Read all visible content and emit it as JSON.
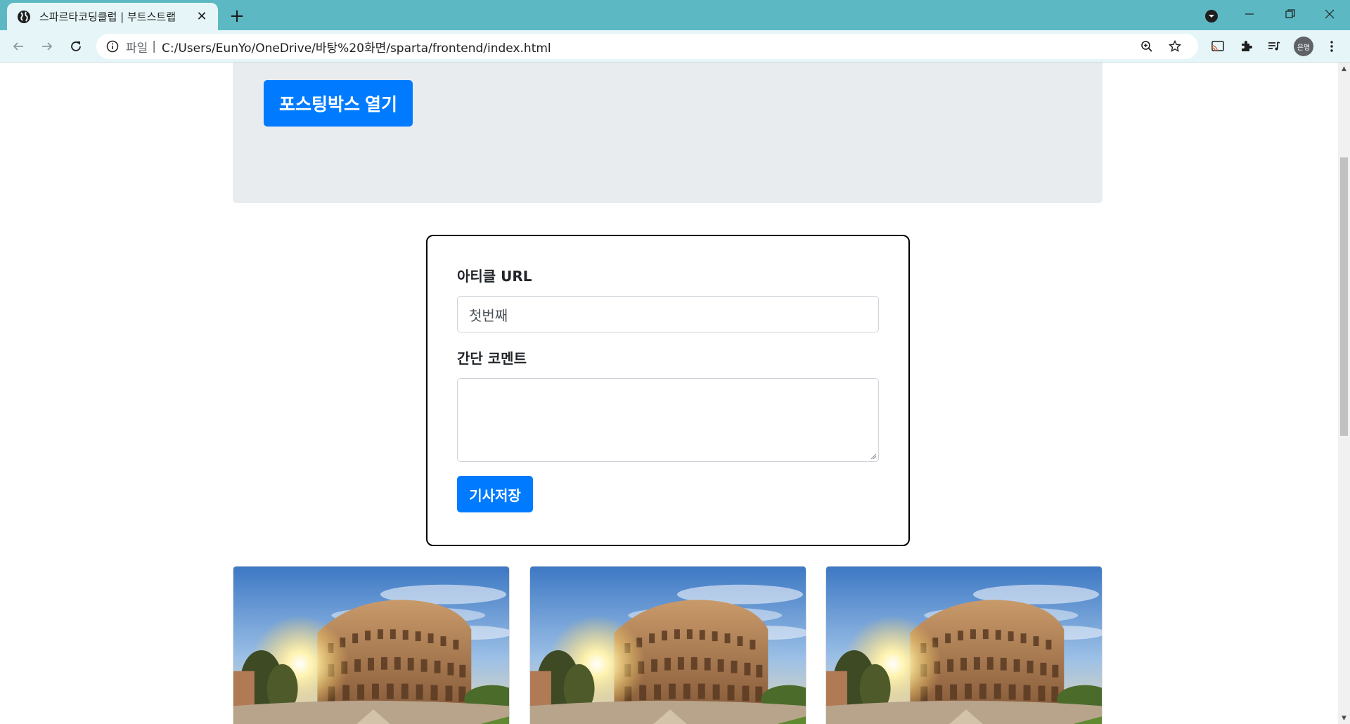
{
  "browser": {
    "tab_title": "스파르타코딩클럽 | 부트스트랩",
    "tab_close": "✕",
    "new_tab": "+",
    "omnibox_scheme": "파일",
    "omnibox_separator": "|",
    "url": "C:/Users/EunYo/OneDrive/바탕%20화면/sparta/frontend/index.html",
    "profile_initials": "은영"
  },
  "page": {
    "open_posting_button": "포스팅박스 열기",
    "form": {
      "url_label": "아티클 URL",
      "url_value": "첫번째",
      "comment_label": "간단 코멘트",
      "comment_value": "",
      "save_button": "기사저장"
    },
    "cards": [
      {
        "image": "colosseum-photo"
      },
      {
        "image": "colosseum-photo"
      },
      {
        "image": "colosseum-photo"
      }
    ]
  },
  "colors": {
    "tabstrip": "#5cb9c4",
    "toolbar": "#e6f6f8",
    "primary_button": "#007bff",
    "jumbotron": "#e9ecef"
  }
}
